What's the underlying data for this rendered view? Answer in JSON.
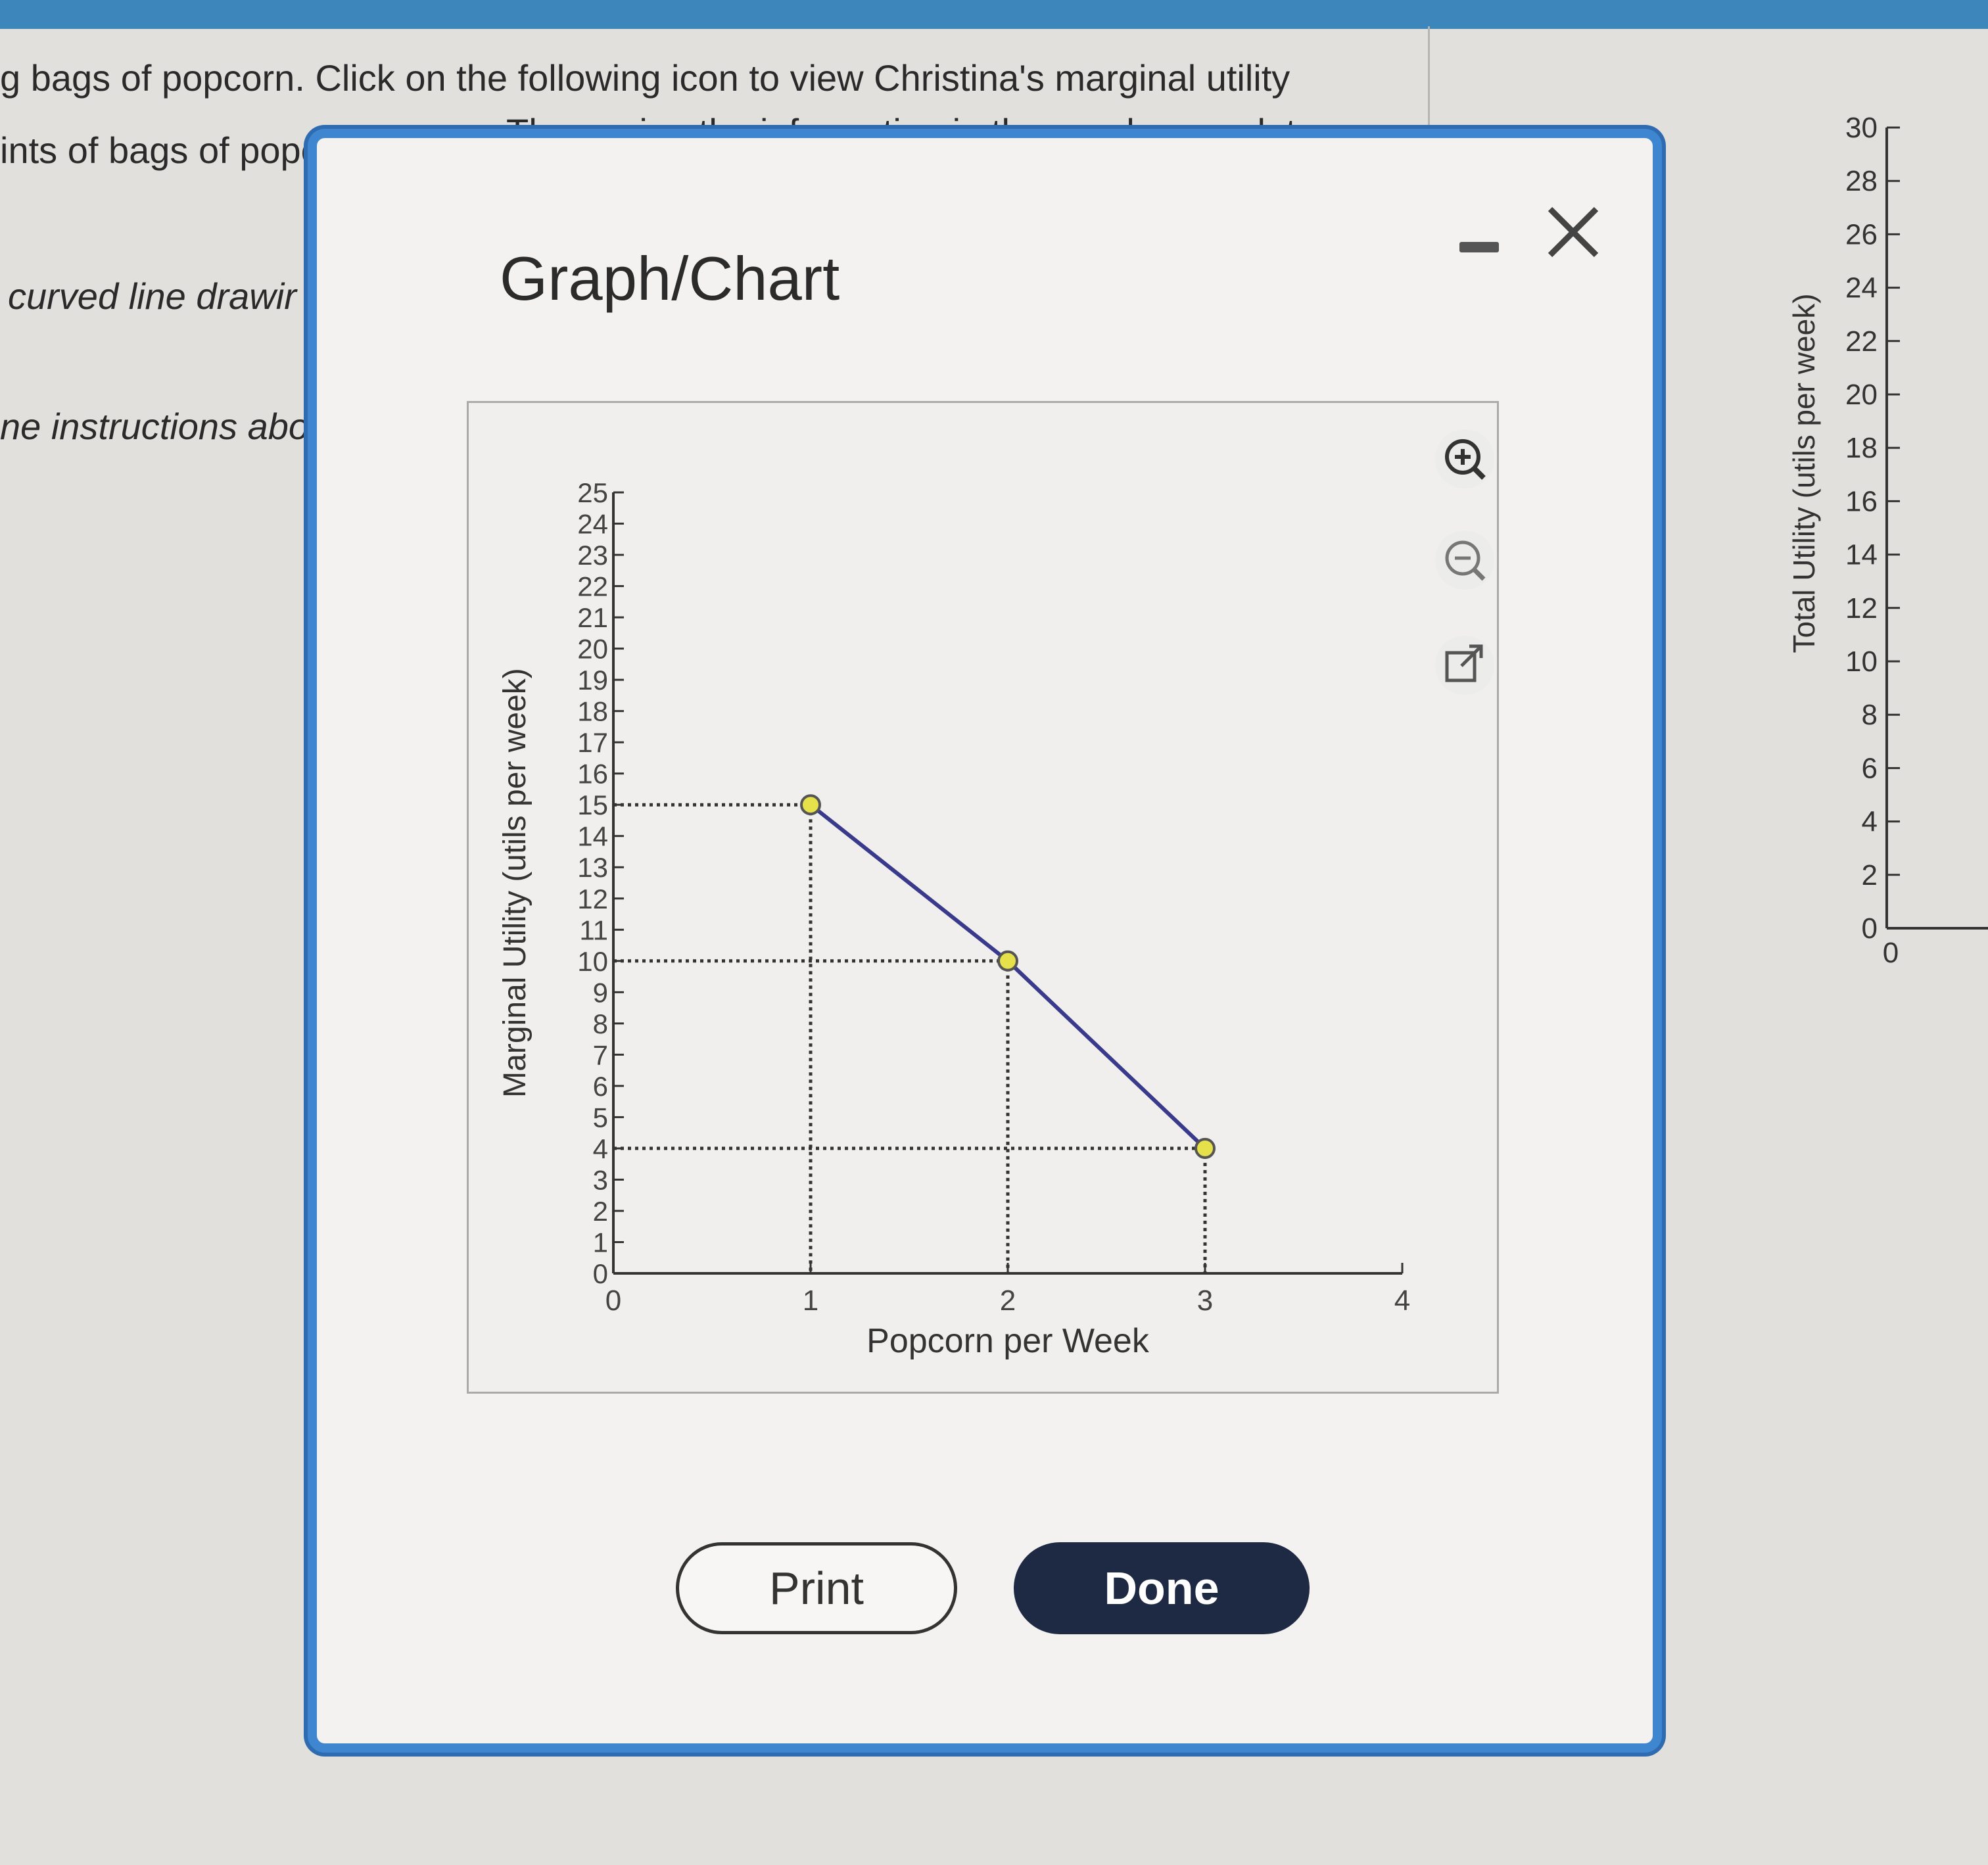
{
  "background": {
    "line1": "g bags of popcorn.  Click on the following icon  to view Christina's marginal utility",
    "line2": "ints of bags of popcorn:",
    "line2_tail": "Then using the information in the graph, complete",
    "line3": "curved line drawir",
    "line4": "ne instructions abo",
    "icons": {
      "chart": "line-chart-icon",
      "cursor": "mouse-cursor-icon"
    },
    "right_chart": {
      "ylabel": "Total Utility (utils per week)",
      "y_ticks": [
        "30",
        "28",
        "26",
        "24",
        "22",
        "20",
        "18",
        "16",
        "14",
        "12",
        "10",
        "8",
        "6",
        "4",
        "2",
        "0"
      ],
      "x_tick": "0"
    }
  },
  "modal": {
    "title": "Graph/Chart",
    "icons": {
      "minimize": "minimize-icon",
      "close": "close-icon",
      "zoom_in": "zoom-in-icon",
      "zoom_out": "zoom-out-icon",
      "external": "open-external-icon"
    },
    "print_label": "Print",
    "done_label": "Done"
  },
  "chart_data": {
    "type": "line",
    "title": "",
    "xlabel": "Popcorn per Week",
    "ylabel": "Marginal Utility (utils per week)",
    "xlim": [
      0,
      4
    ],
    "ylim": [
      0,
      25
    ],
    "x_ticks": [
      "0",
      "1",
      "2",
      "3",
      "4"
    ],
    "y_ticks": [
      "0",
      "1",
      "2",
      "3",
      "4",
      "5",
      "6",
      "7",
      "8",
      "9",
      "10",
      "11",
      "12",
      "13",
      "14",
      "15",
      "16",
      "17",
      "18",
      "19",
      "20",
      "21",
      "22",
      "23",
      "24",
      "25"
    ],
    "x": [
      1,
      2,
      3
    ],
    "series": [
      {
        "values": [
          15,
          10,
          4
        ]
      }
    ],
    "guide_lines": "dotted",
    "colors": {
      "line": "#3a3a8c",
      "point_fill": "#e6e04a",
      "guide": "#333333"
    }
  }
}
